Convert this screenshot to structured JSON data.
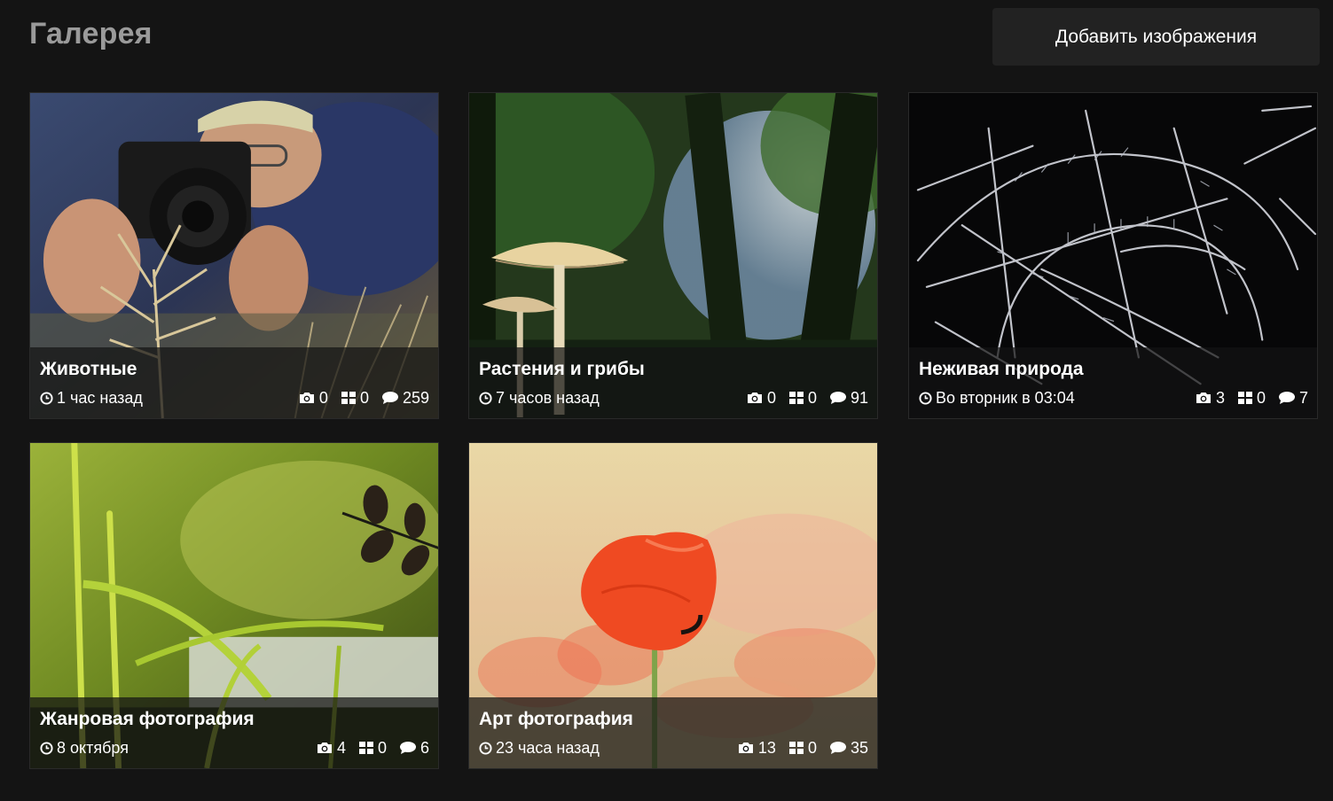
{
  "header": {
    "title": "Галерея",
    "add_button_label": "Добавить изображения"
  },
  "cards": [
    {
      "title": "Животные",
      "time": "1 час назад",
      "photos": "0",
      "albums": "0",
      "comments": "259"
    },
    {
      "title": "Растения и грибы",
      "time": "7 часов назад",
      "photos": "0",
      "albums": "0",
      "comments": "91"
    },
    {
      "title": "Неживая природа",
      "time": "Во вторник в 03:04",
      "photos": "3",
      "albums": "0",
      "comments": "7"
    },
    {
      "title": "Жанровая фотография",
      "time": "8 октября",
      "photos": "4",
      "albums": "0",
      "comments": "6"
    },
    {
      "title": "Арт фотография",
      "time": "23 часа назад",
      "photos": "13",
      "albums": "0",
      "comments": "35"
    }
  ],
  "icons": {
    "time": "clock-icon",
    "photos": "camera-icon",
    "albums": "grid-icon",
    "comments": "speech-bubble-icon"
  }
}
